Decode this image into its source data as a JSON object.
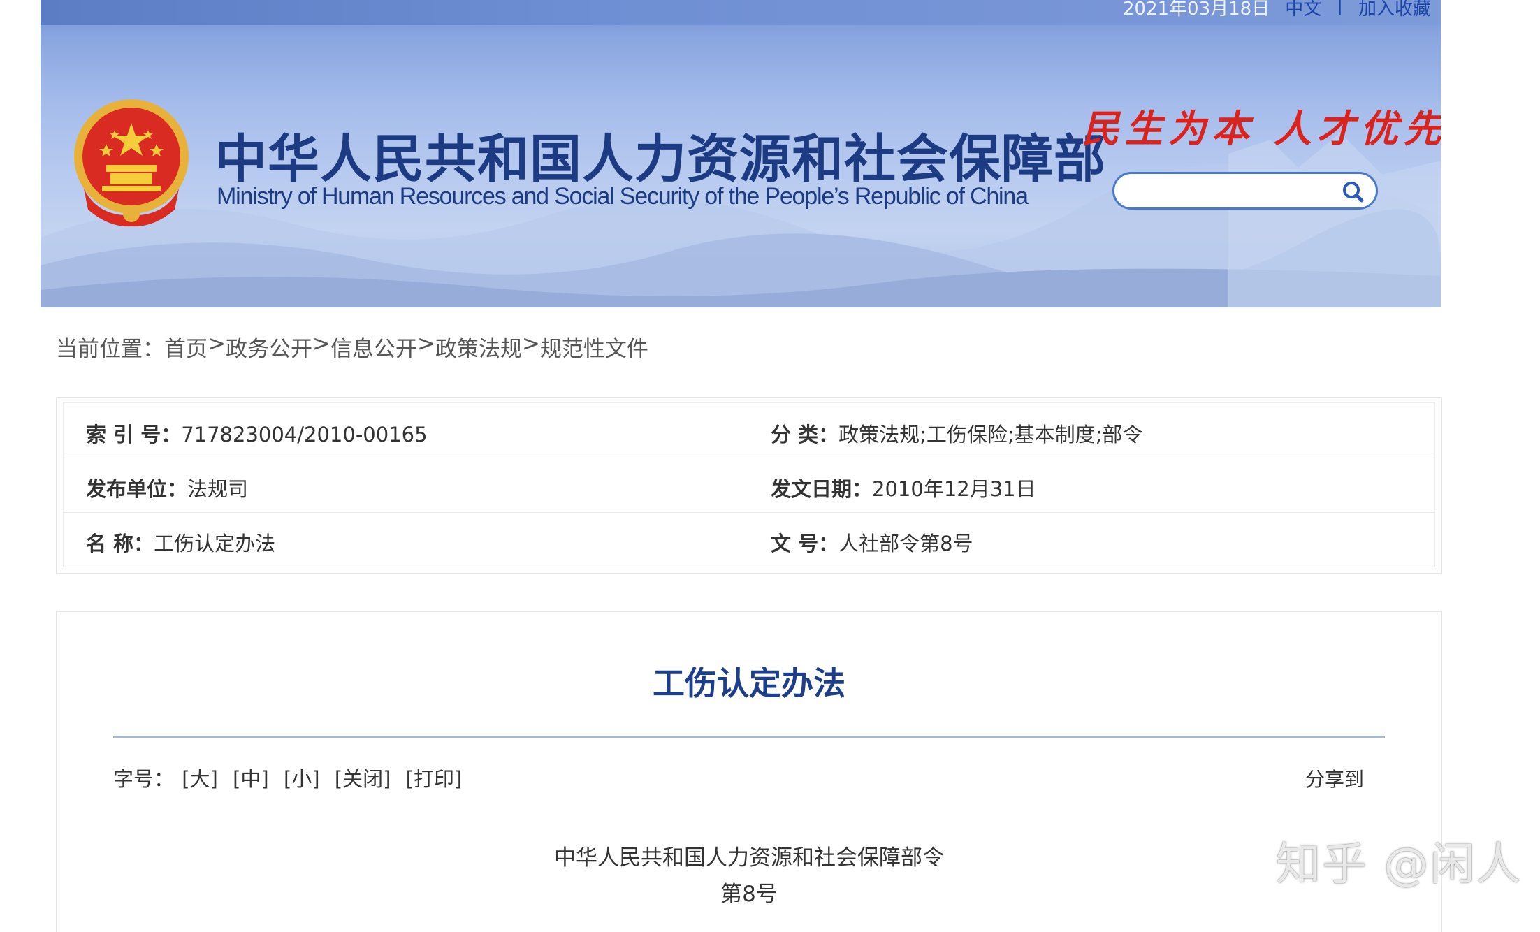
{
  "header": {
    "date": "2021年03月18日",
    "lang_link": "中文",
    "divider": "|",
    "bookmark_link": "加入收藏",
    "title_cn": "中华人民共和国人力资源和社会保障部",
    "title_en": "Ministry of Human Resources and Social Security of the People’s Republic of China",
    "slogan": "民生为本 人才优先",
    "search": {
      "placeholder": ""
    },
    "colors": {
      "banner": "#8aa6e0",
      "title": "#1c3b82",
      "slogan": "#d8231f"
    }
  },
  "breadcrumb": {
    "label": "当前位置：",
    "items": [
      "首页",
      "政务公开",
      "信息公开",
      "政策法规",
      "规范性文件"
    ],
    "sep": ">"
  },
  "info": {
    "rows": [
      {
        "lk": "索 引 号：",
        "lv": "717823004/2010-00165",
        "rk": "分    类：",
        "rv": "政策法规;工伤保险;基本制度;部令"
      },
      {
        "lk": "发布单位：",
        "lv": "法规司",
        "rk": "发文日期：",
        "rv": "2010年12月31日"
      },
      {
        "lk": "名    称：",
        "lv": "工伤认定办法",
        "rk": "文    号：",
        "rv": "人社部令第8号"
      }
    ]
  },
  "article": {
    "title": "工伤认定办法",
    "fontsize_label": "字号：",
    "fontsize_options": [
      "[大]",
      "[中]",
      "[小]",
      "[关闭]",
      "[打印]"
    ],
    "share_label": "分享到",
    "decree_line1": "中华人民共和国人力资源和社会保障部令",
    "decree_line2": "第8号"
  },
  "watermark": "知乎 @闲人"
}
